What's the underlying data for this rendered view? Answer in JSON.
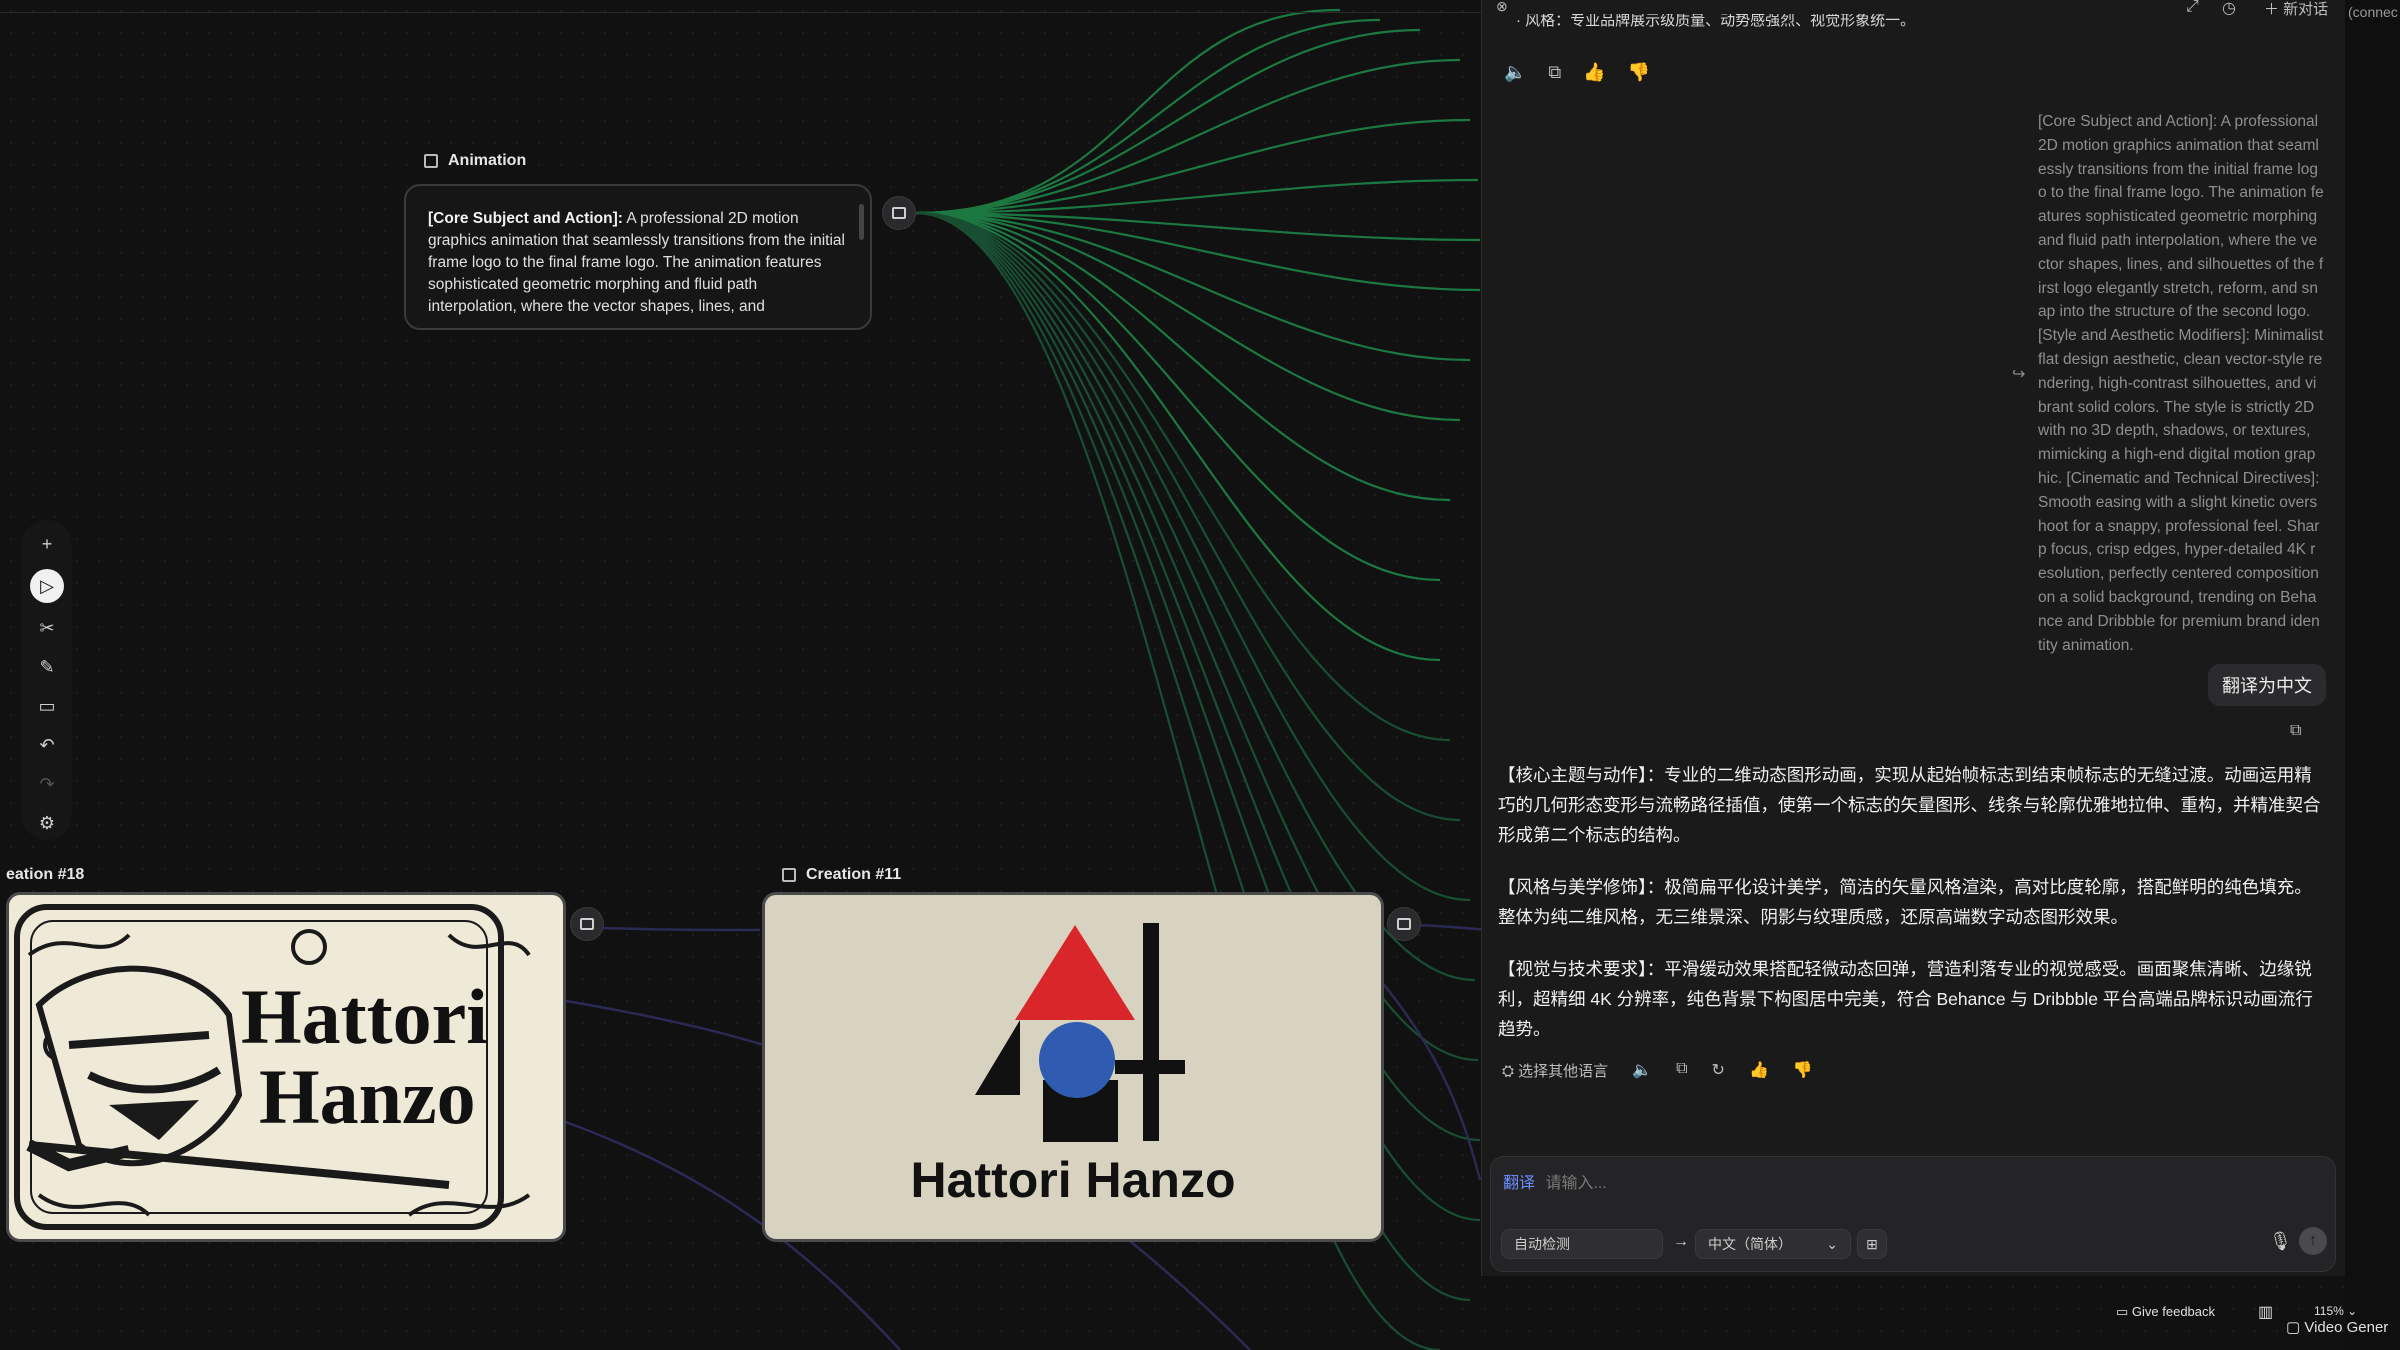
{
  "canvas": {
    "text_node": {
      "title": "Animation",
      "bold_lead": "[Core Subject and Action]:",
      "body": " A professional 2D motion graphics animation that seamlessly transitions from the initial frame logo to the final frame logo. The animation features sophisticated geometric morphing and fluid path interpolation, where the vector shapes, lines, and"
    },
    "image_nodes": [
      {
        "title": "eation #18",
        "logo_text_line1": "Hattori",
        "logo_text_line2": "Hanzo"
      },
      {
        "title": "Creation #11",
        "logo_text": "Hattori Hanzo"
      }
    ],
    "toolbar": [
      "plus-icon",
      "pointer-icon",
      "scissors-icon",
      "pen-icon",
      "comment-icon",
      "undo-icon",
      "redo-icon",
      "settings-icon"
    ]
  },
  "panel": {
    "top_truncated_text": "· 风格：专业品牌展示级质量、动势感强烈、视觉形象统一。",
    "new_chat_label": "新对话",
    "connect_label": "(connec",
    "user_message": "[Core Subject and Action]: A professional 2D motion graphics animation that seamlessly transitions from the initial frame logo to the final frame logo. The animation features sophisticated geometric morphing and fluid path interpolation, where the vector shapes, lines, and silhouettes of the first logo elegantly stretch, reform, and snap into the structure of the second logo. [Style and Aesthetic Modifiers]: Minimalist flat design aesthetic, clean vector-style rendering, high-contrast silhouettes, and vibrant solid colors. The style is strictly 2D with no 3D depth, shadows, or textures, mimicking a high-end digital motion graphic. [Cinematic and Technical Directives]: Smooth easing with a slight kinetic overshoot for a snappy, professional feel. Sharp focus, crisp edges, hyper-detailed 4K resolution, perfectly centered composition on a solid background, trending on Behance and Dribbble for premium brand identity animation.",
    "translate_button": "翻译为中文",
    "reply_paragraphs": [
      "【核心主题与动作】：专业的二维动态图形动画，实现从起始帧标志到结束帧标志的无缝过渡。动画运用精巧的几何形态变形与流畅路径插值，使第一个标志的矢量图形、线条与轮廓优雅地拉伸、重构，并精准契合形成第二个标志的结构。",
      "【风格与美学修饰】：极简扁平化设计美学，简洁的矢量风格渲染，高对比度轮廓，搭配鲜明的纯色填充。整体为纯二维风格，无三维景深、阴影与纹理质感，还原高端数字动态图形效果。",
      "【视觉与技术要求】：平滑缓动效果搭配轻微动态回弹，营造利落专业的视觉感受。画面聚焦清晰、边缘锐利，超精细 4K 分辨率，纯色背景下构图居中完美，符合 Behance 与 Dribbble 平台高端品牌标识动画流行趋势。"
    ],
    "choose_language": "选择其他语言",
    "input": {
      "mode_tag": "翻译",
      "placeholder": "请输入...",
      "source_lang": "自动检测",
      "target_lang": "中文（简体）"
    }
  },
  "bottom": {
    "feedback": "Give feedback",
    "zoom": "115%",
    "video_label": "Video Gener"
  }
}
